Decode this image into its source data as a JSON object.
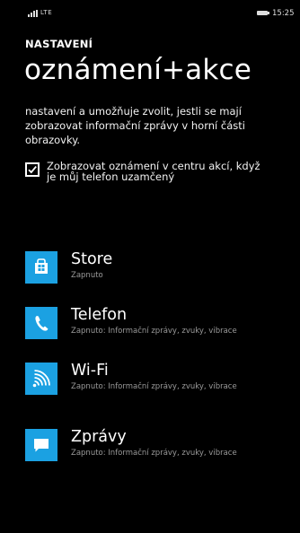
{
  "status_bar": {
    "network": "LTE",
    "time": "15:25"
  },
  "header": {
    "app_title": "NASTAVENÍ",
    "page_title": "oznámení+akce"
  },
  "description": "nastavení a umožňuje zvolit, jestli se mají zobrazovat informační zprávy v horní části obrazovky.",
  "lock_screen_option": {
    "checked": true,
    "label": "Zobrazovat oznámení v centru akcí, když je můj telefon uzamčený"
  },
  "apps": [
    {
      "name": "Store",
      "status": "Zapnuto",
      "icon": "store-icon",
      "tile_color": "#1ba1e2"
    },
    {
      "name": "Telefon",
      "status": "Zapnuto: Informační zprávy, zvuky, vibrace",
      "icon": "phone-icon",
      "tile_color": "#1ba1e2"
    },
    {
      "name": "Wi-Fi",
      "status": "Zapnuto: Informační zprávy, zvuky, vibrace",
      "icon": "wifi-icon",
      "tile_color": "#1ba1e2"
    },
    {
      "name": "Zprávy",
      "status": "Zapnuto: Informační zprávy, zvuky, vibrace",
      "icon": "message-icon",
      "tile_color": "#1ba1e2"
    }
  ]
}
